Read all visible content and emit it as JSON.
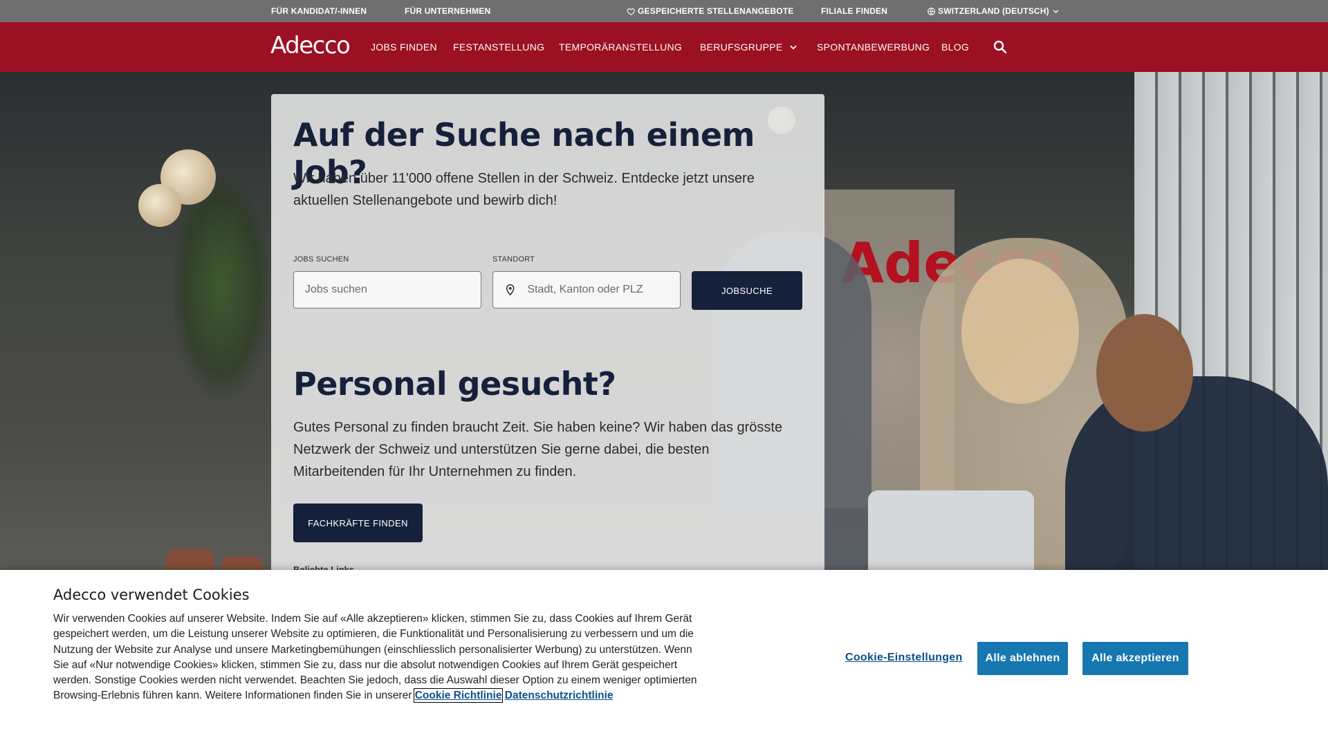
{
  "utility_bar": {
    "candidates": "FÜR KANDIDAT/-INNEN",
    "companies": "FÜR UNTERNEHMEN",
    "saved_jobs": "GESPEICHERTE STELLENANGEBOTE",
    "find_branch": "FILIALE FINDEN",
    "region": "SWITZERLAND (DEUTSCH)"
  },
  "nav": {
    "logo": "Adecco",
    "items": [
      "JOBS FINDEN",
      "FESTANSTELLUNG",
      "TEMPORÄRANSTELLUNG",
      "BERUFSGRUPPE",
      "SPONTANBEWERBUNG",
      "BLOG"
    ],
    "search_icon": "search-icon"
  },
  "hero": {
    "title": "Auf der Suche nach einem Job?",
    "subtitle": "Wir haben über 11'000 offene Stellen in der Schweiz. Entdecke jetzt unsere aktuellen Stellenangebote und bewirb dich!",
    "jobs_label": "JOBS SUCHEN",
    "jobs_placeholder": "Jobs suchen",
    "location_label": "STANDORT",
    "location_placeholder": "Stadt, Kanton oder PLZ",
    "search_button": "JOBSUCHE",
    "title2": "Personal gesucht?",
    "subtitle2": "Gutes Personal zu finden braucht Zeit. Sie haben keine? Wir haben das grösste Netzwerk der Schweiz und unterstützen Sie gerne dabei, die besten Mitarbeitenden für Ihr Unternehmen zu finden.",
    "talent_button": "FACHKRÄFTE FINDEN",
    "popular_links": "Beliebte Links",
    "bg_sign": "Adecco"
  },
  "cookie": {
    "title": "Adecco verwendet Cookies",
    "text": "Wir verwenden Cookies auf unserer Website. Indem Sie auf «Alle akzeptieren» klicken, stimmen Sie zu, dass Cookies auf Ihrem Gerät gespeichert werden, um die Leistung unserer Website zu optimieren, die Funktionalität und Personalisierung zu verbessern und um die Nutzung der Website zur Analyse und unsere Marketingbemühungen (einschliesslich personalisierter Werbung) zu unterstützen. Wenn Sie auf «Nur notwendige Cookies» klicken, stimmen Sie zu, dass nur die absolut notwendigen Cookies auf Ihrem Gerät gespeichert werden. Sonstige Cookies werden nicht verwendet. Beachten Sie jedoch, dass die Auswahl dieser Option zu einem weniger optimierten Browsing-Erlebnis führen kann. Weitere Informationen finden Sie in unserer",
    "cookie_policy_link": "Cookie Richtlinie",
    "privacy_link": "Datenschutzrichtlinie",
    "settings_button": "Cookie-Einstellungen",
    "reject_button": "Alle ablehnen",
    "accept_button": "Alle akzeptieren"
  },
  "colors": {
    "nav_red": "#9b1022",
    "utility_grey": "#6f6f6f",
    "navy": "#15213a",
    "cookie_blue": "#1777b0"
  }
}
